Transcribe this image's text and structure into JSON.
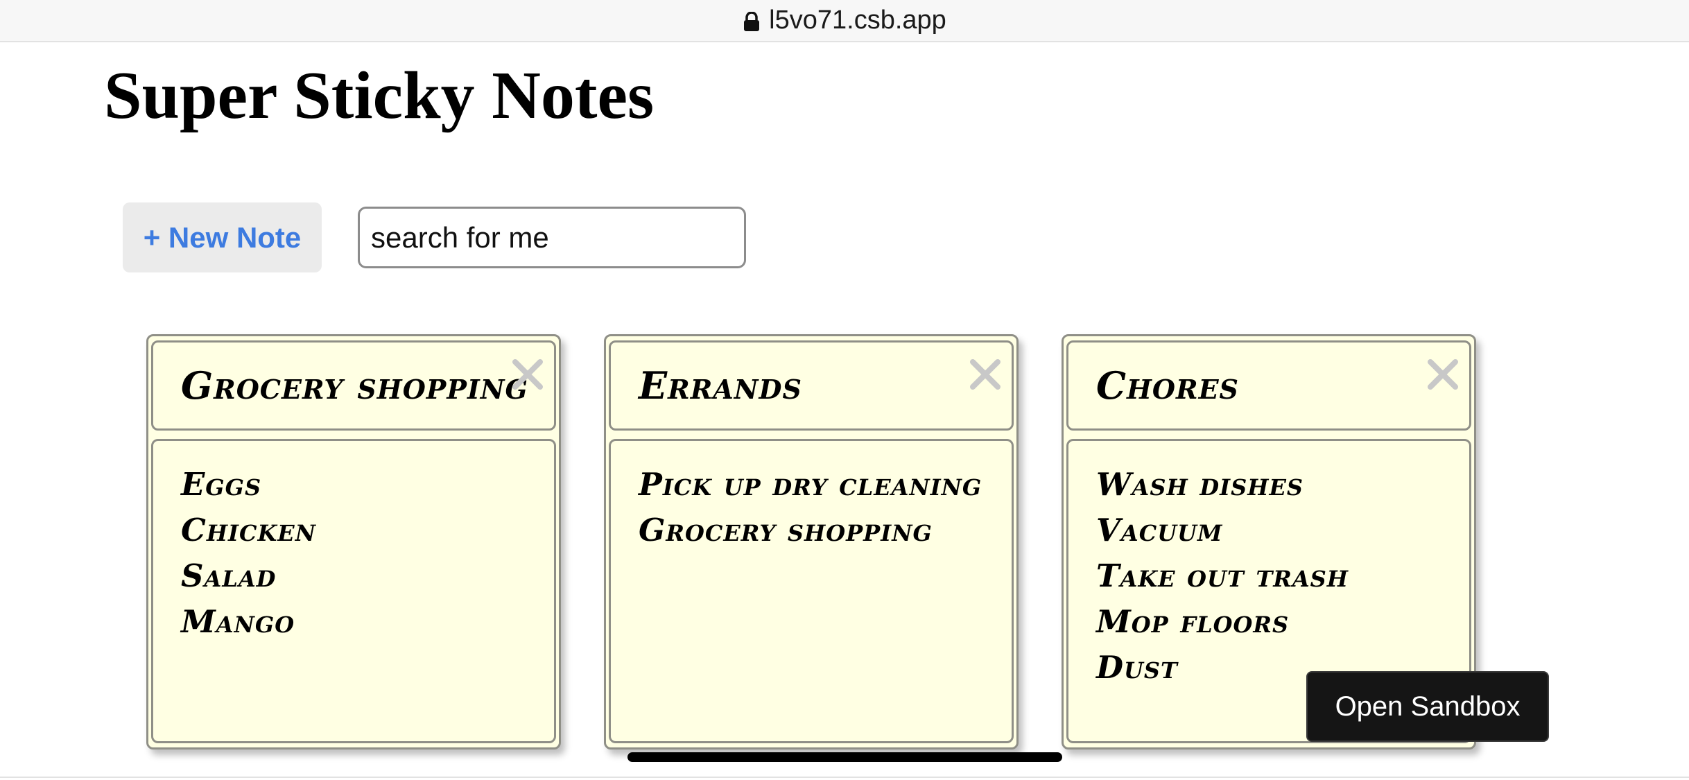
{
  "browser": {
    "url": "l5vo71.csb.app",
    "lock_icon": "lock-icon"
  },
  "app": {
    "title": "Super Sticky Notes",
    "new_note_label": "+ New Note",
    "search_value": "search for me",
    "search_placeholder": ""
  },
  "notes": [
    {
      "title": "Grocery shopping",
      "items": [
        "Eggs",
        "Chicken",
        "Salad",
        "Mango"
      ]
    },
    {
      "title": "Errands",
      "items": [
        "Pick up dry cleaning",
        "Grocery shopping"
      ]
    },
    {
      "title": "Chores",
      "items": [
        "Wash dishes",
        "Vacuum",
        "Take out trash",
        "Mop floors",
        "Dust"
      ]
    }
  ],
  "close_icon": "close-icon",
  "sandbox_button_label": "Open Sandbox",
  "colors": {
    "note_bg": "#ffffe3",
    "accent": "#3d7be0",
    "close_x": "#c8c8c8"
  }
}
